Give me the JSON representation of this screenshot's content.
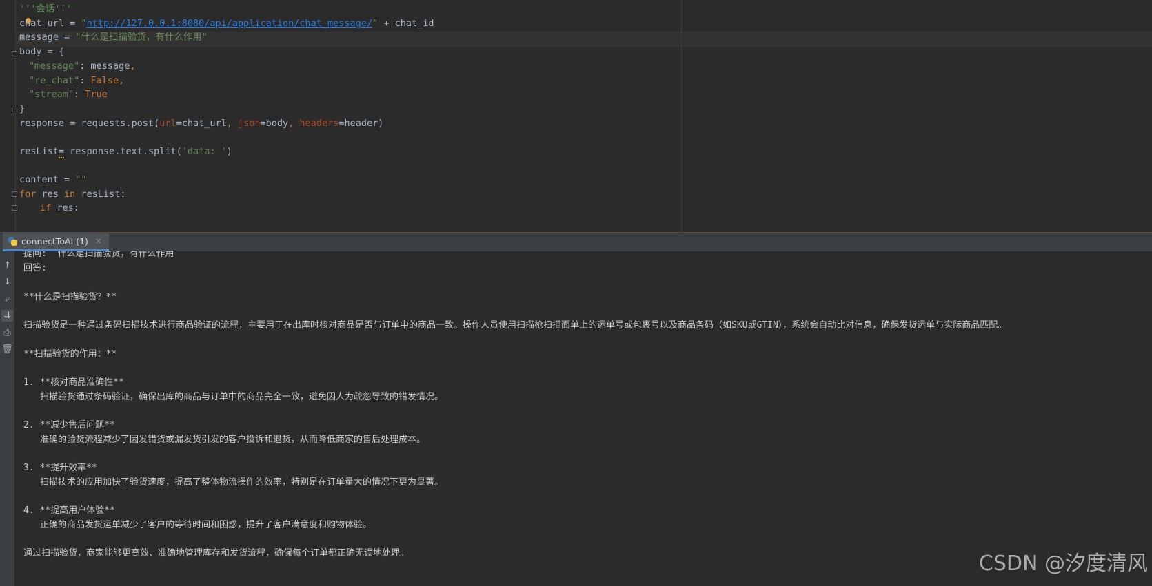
{
  "editor": {
    "comment": "'''会话'''",
    "line_chat_url": {
      "name": "chat_url",
      "op": " = ",
      "url": "http://127.0.0.1:8080/api/application/chat_message/",
      "tail": " + chat_id"
    },
    "line_message": {
      "name": "message",
      "op": " = ",
      "value": "\"什么是扫描验货，有什么作用\""
    },
    "line_body_open": "body = {",
    "line_body_message": {
      "key": "\"message\"",
      "colon": ": ",
      "value": "message",
      "comma": ","
    },
    "line_body_rechat": {
      "key": "\"re_chat\"",
      "colon": ": ",
      "value": "False",
      "comma": ","
    },
    "line_body_stream": {
      "key": "\"stream\"",
      "colon": ": ",
      "value": "True"
    },
    "line_body_close": "}",
    "line_response": {
      "start": "response = requests.post(",
      "p1": "url",
      "v1": "=chat_url",
      "sep1": ", ",
      "p2": "json",
      "v2": "=body",
      "sep2": ", ",
      "p3": "headers",
      "v3": "=header)"
    },
    "line_reslist": {
      "name": "resList",
      "op": "=",
      "rest": " response.text.split(",
      "arg": "'data: '",
      "end": ")"
    },
    "line_content": {
      "name": "content = ",
      "value": "\"\""
    },
    "line_for": {
      "kw1": "for",
      "mid": " res ",
      "kw2": "in",
      "tail": " resList:"
    },
    "line_if": {
      "kw": "if",
      "tail": " res:"
    }
  },
  "run": {
    "tab_label": "connectToAI (1)",
    "tab_close": "×",
    "lines": [
      "提问:  什么是扫描验货，有什么作用",
      "回答:",
      "",
      "**什么是扫描验货？**",
      "",
      "扫描验货是一种通过条码扫描技术进行商品验证的流程，主要用于在出库时核对商品是否与订单中的商品一致。操作人员使用扫描枪扫描面单上的运单号或包裹号以及商品条码（如SKU或GTIN），系统会自动比对信息，确保发货运单与实际商品匹配。",
      "",
      "**扫描验货的作用：**",
      "",
      "1. **核对商品准确性**",
      "扫描验货通过条码验证，确保出库的商品与订单中的商品完全一致，避免因人为疏忽导致的错发情况。",
      "",
      "2. **减少售后问题**",
      "准确的验货流程减少了因发错货或漏发货引发的客户投诉和退货，从而降低商家的售后处理成本。",
      "",
      "3. **提升效率**",
      "扫描技术的应用加快了验货速度，提高了整体物流操作的效率，特别是在订单量大的情况下更为显著。",
      "",
      "4. **提高用户体验**",
      "正确的商品发货运单减少了客户的等待时间和困惑，提升了客户满意度和购物体验。",
      "",
      "通过扫描验货，商家能够更高效、准确地管理库存和发货流程，确保每个订单都正确无误地处理。"
    ],
    "toolbar": {
      "up_icon": "↑",
      "down_icon": "↓",
      "wrap_icon": "⤶",
      "scroll_end_icon": "⇊",
      "print_icon": "⎙",
      "clear_icon": "🗑"
    }
  },
  "watermark": "CSDN @汐度清风"
}
